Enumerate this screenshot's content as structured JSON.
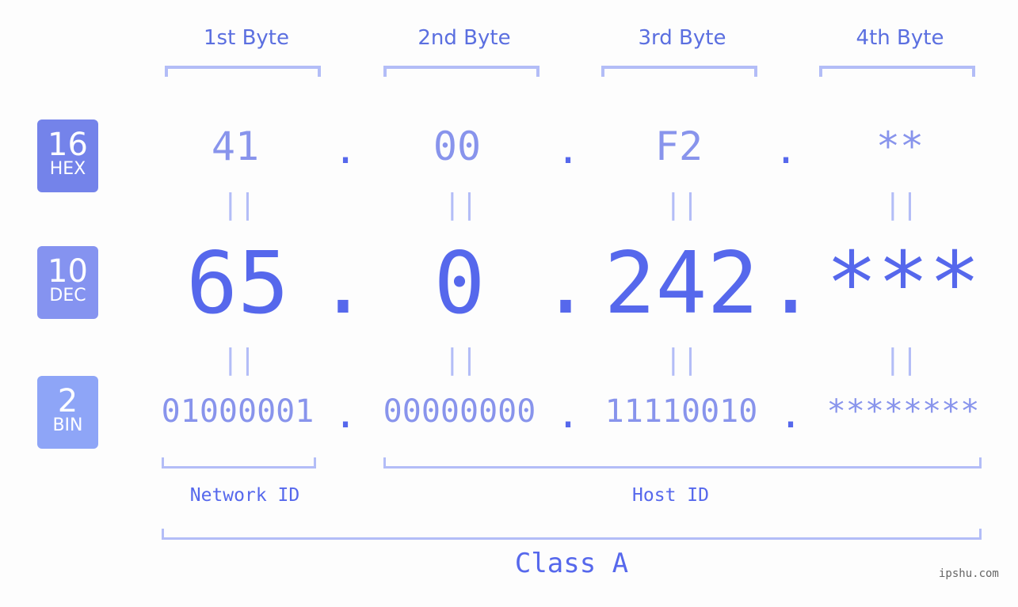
{
  "byte_headers": [
    "1st Byte",
    "2nd Byte",
    "3rd Byte",
    "4th Byte"
  ],
  "rows": {
    "hex": {
      "base": "16",
      "label": "HEX",
      "color": "#7483ea",
      "values": [
        "41",
        "00",
        "F2",
        "**"
      ]
    },
    "dec": {
      "base": "10",
      "label": "DEC",
      "color": "#8593f0",
      "values": [
        "65",
        "0",
        "242",
        "***"
      ]
    },
    "bin": {
      "base": "2",
      "label": "BIN",
      "color": "#8ea5f7",
      "values": [
        "01000001",
        "00000000",
        "11110010",
        "********"
      ]
    }
  },
  "separator": ".",
  "equals": "||",
  "network_label": "Network ID",
  "host_label": "Host ID",
  "class_label": "Class A",
  "watermark": "ipshu.com",
  "colors": {
    "accent": "#5668ec",
    "light": "#8894ec",
    "bracket": "#b3bdf7"
  }
}
